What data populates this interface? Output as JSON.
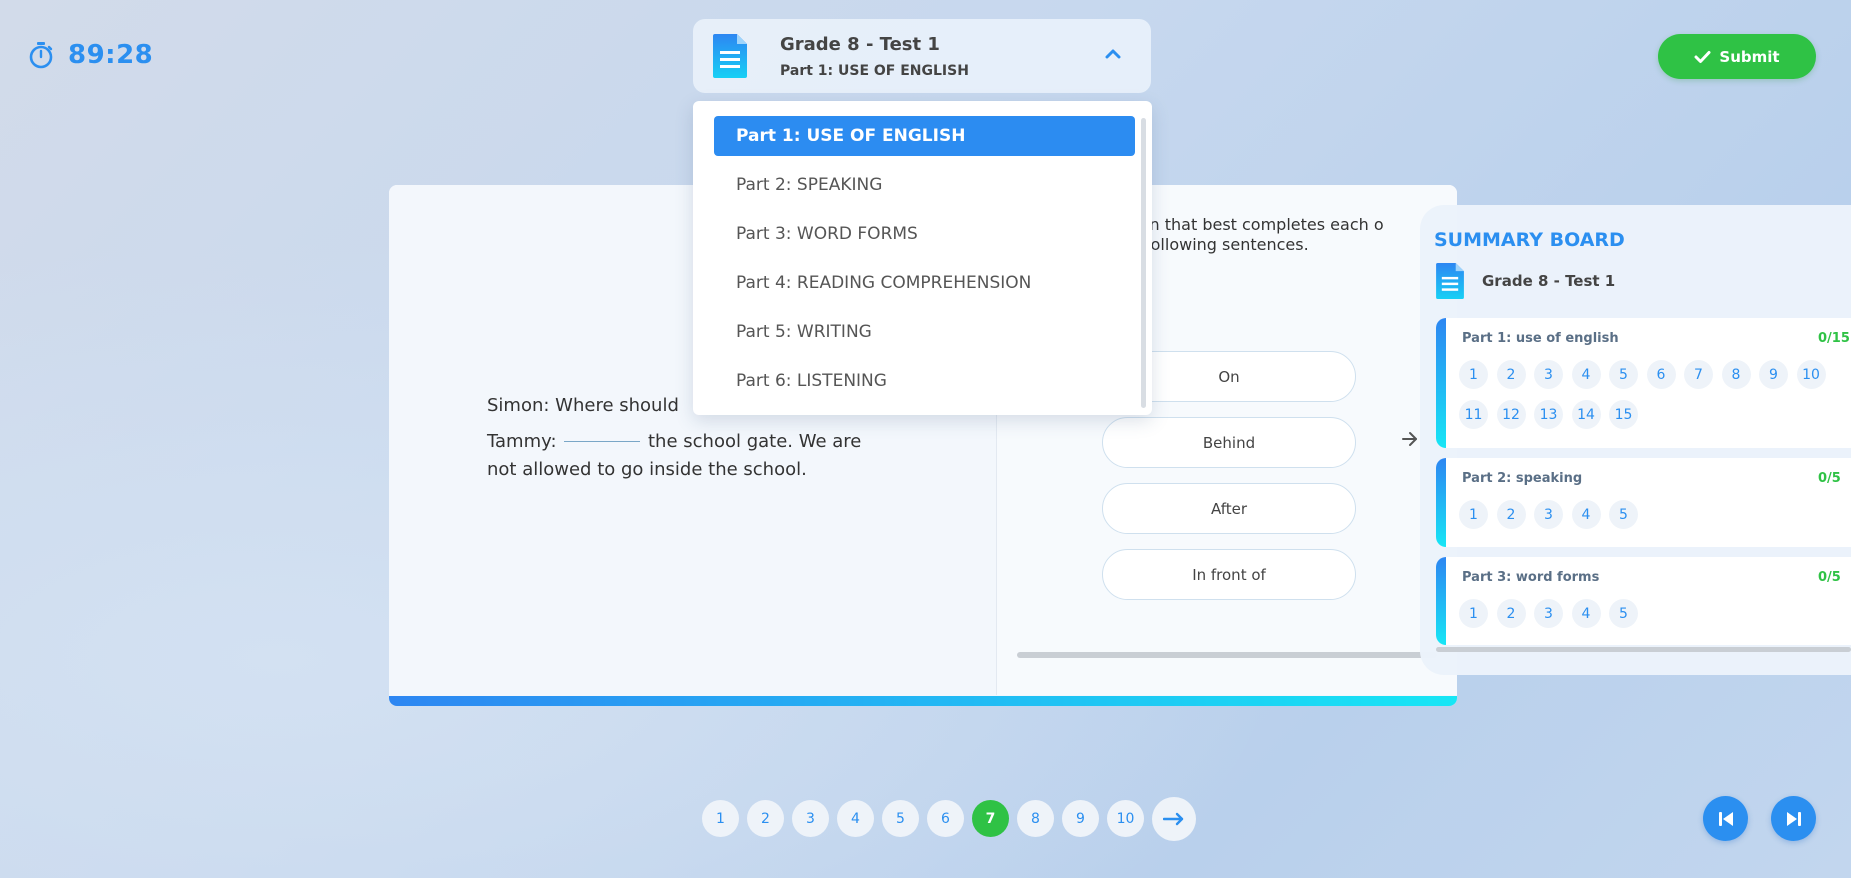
{
  "timer": {
    "text": "89:28",
    "icon": "stopwatch-icon"
  },
  "test": {
    "title": "Grade 8 - Test 1",
    "current_part": "Part 1: USE OF ENGLISH"
  },
  "submit": {
    "label": "Submit"
  },
  "dropdown": {
    "items": [
      "Part 1: USE OF ENGLISH",
      "Part 2: SPEAKING",
      "Part 3: WORD FORMS",
      "Part 4: READING COMPREHENSION",
      "Part 5: WRITING",
      "Part 6: LISTENING"
    ],
    "selected_index": 0
  },
  "question": {
    "instruction_line1": "tion that best completes each o",
    "instruction_line2": "following sentences.",
    "passage_line1": "Simon: Where should",
    "passage_line2_before": "Tammy:",
    "passage_line2_after": "the school gate. We are",
    "passage_line3": "not allowed to go inside the school.",
    "options": [
      "On",
      "Behind",
      "After",
      "In front of"
    ]
  },
  "summary": {
    "title": "SUMMARY BOARD",
    "test_name": "Grade 8 - Test 1",
    "parts": [
      {
        "name": "Part 1: use of english",
        "score": "0/15",
        "questions": [
          "1",
          "2",
          "3",
          "4",
          "5",
          "6",
          "7",
          "8",
          "9",
          "10",
          "11",
          "12",
          "13",
          "14",
          "15"
        ]
      },
      {
        "name": "Part 2: speaking",
        "score": "0/5",
        "questions": [
          "1",
          "2",
          "3",
          "4",
          "5"
        ]
      },
      {
        "name": "Part 3: word forms",
        "score": "0/5",
        "questions": [
          "1",
          "2",
          "3",
          "4",
          "5"
        ]
      }
    ]
  },
  "pagination": {
    "pages": [
      "1",
      "2",
      "3",
      "4",
      "5",
      "6",
      "7",
      "8",
      "9",
      "10"
    ],
    "current": "7"
  },
  "colors": {
    "accent": "#2b8ff0",
    "success": "#2fc245",
    "gradient_start": "#2d86f2",
    "gradient_end": "#17e6f5"
  }
}
